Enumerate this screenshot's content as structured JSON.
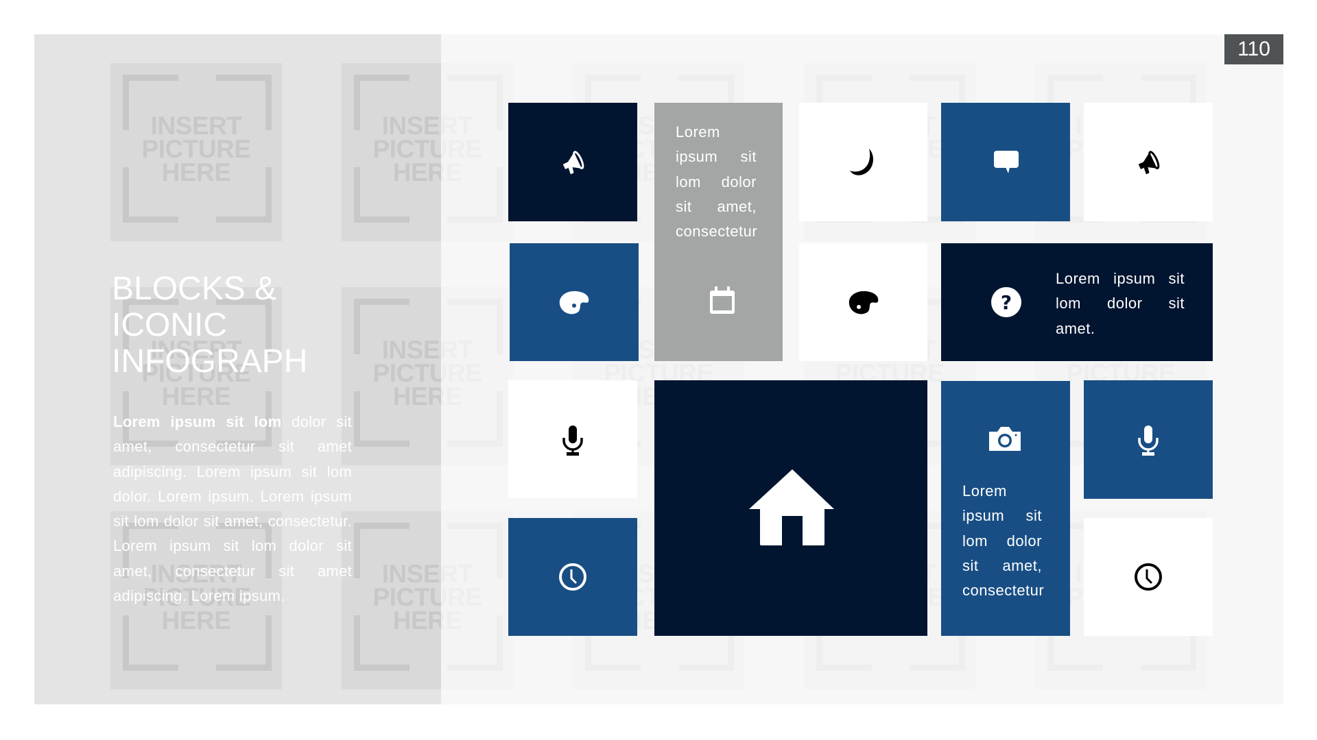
{
  "slide": {
    "page_number": "110",
    "title": "BLOCKS &\nICONIC\nINFOGRAPH",
    "paragraph_lead": "Lorem ipsum sit lom",
    "paragraph_rest": " dolor sit amet, consectetur sit amet adipiscing. Lorem ipsum sit lom dolor. Lorem ipsum. Lorem ipsum sit lom dolor sit amet, consectetur. Lorem ipsum sit lom dolor sit amet, consectetur sit amet adipiscing. Lorem ipsum.",
    "placeholder_text": "INSERT\nPICTURE\nHERE"
  },
  "colors": {
    "navy": "#021530",
    "blue": "#184e84",
    "gray": "#a3a6a5",
    "white": "#ffffff",
    "page_badge": "#4f5356"
  },
  "blocks": {
    "b1": {
      "icon": "megaphone-icon",
      "color": "navy"
    },
    "b2": {
      "icon": "calendar-icon",
      "color": "gray",
      "text": "Lorem ipsum sit lom dolor sit amet, consectetur"
    },
    "b3": {
      "icon": "moon-icon",
      "color": "white"
    },
    "b4": {
      "icon": "chat-bubble-icon",
      "color": "blue"
    },
    "b5": {
      "icon": "megaphone-icon",
      "color": "white"
    },
    "b6": {
      "icon": "palette-icon",
      "color": "blue"
    },
    "b7": {
      "icon": "palette-icon",
      "color": "white"
    },
    "b8": {
      "icon": "help-icon",
      "color": "navy",
      "text": "Lorem ipsum sit lom dolor sit amet."
    },
    "b9": {
      "icon": "microphone-icon",
      "color": "white"
    },
    "b10": {
      "icon": "home-icon",
      "color": "navy"
    },
    "b11": {
      "icon": "camera-icon",
      "color": "blue",
      "text": "Lorem ipsum sit lom dolor sit amet, consectetur"
    },
    "b12": {
      "icon": "microphone-icon",
      "color": "blue"
    },
    "b13": {
      "icon": "clock-icon",
      "color": "blue"
    },
    "b14": {
      "icon": "clock-icon",
      "color": "white"
    }
  }
}
